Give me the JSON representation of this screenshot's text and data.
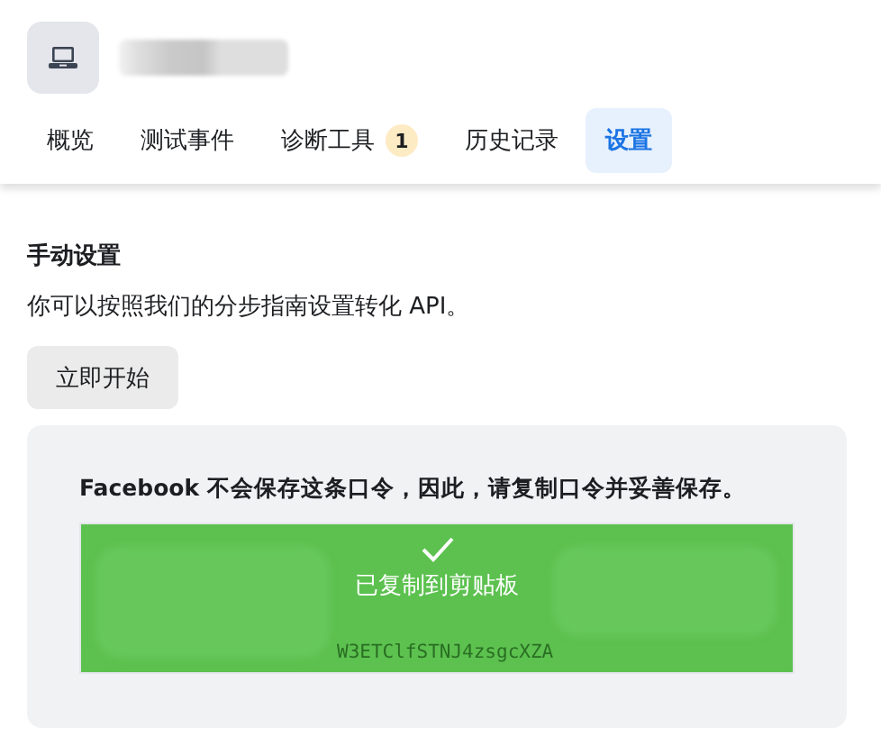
{
  "tabs": [
    {
      "label": "概览",
      "selected": false
    },
    {
      "label": "测试事件",
      "selected": false
    },
    {
      "label": "诊断工具",
      "selected": false,
      "badge": "1"
    },
    {
      "label": "历史记录",
      "selected": false
    },
    {
      "label": "设置",
      "selected": true
    }
  ],
  "section": {
    "title": "手动设置",
    "description": "你可以按照我们的分步指南设置转化 API。",
    "button": "立即开始"
  },
  "token_panel": {
    "notice": "Facebook 不会保存这条口令，因此，请复制口令并妥善保存。",
    "token_lines": [
      "W3ETClfSTNJ4zsgcXZA"
    ],
    "toast": "已复制到剪贴板"
  }
}
